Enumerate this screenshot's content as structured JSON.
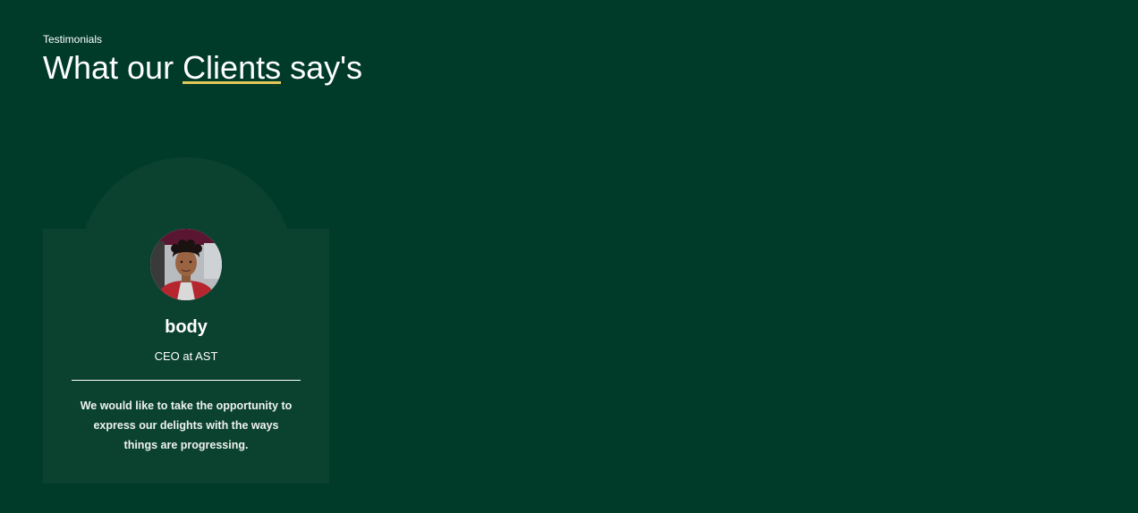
{
  "section": {
    "eyebrow": "Testimonials",
    "title_before": "What our ",
    "title_highlight": "Clients",
    "title_after": " say's"
  },
  "testimonial": {
    "name": "body",
    "role": "CEO at AST",
    "quote": "We would like to take the opportunity to express our delights with the ways things are progressing.",
    "avatar_icon": "client-portrait-photo"
  },
  "colors": {
    "background": "#003b2a",
    "card": "#0a412f",
    "highlight_underline": "#e3c75a",
    "text": "#ffffff"
  }
}
